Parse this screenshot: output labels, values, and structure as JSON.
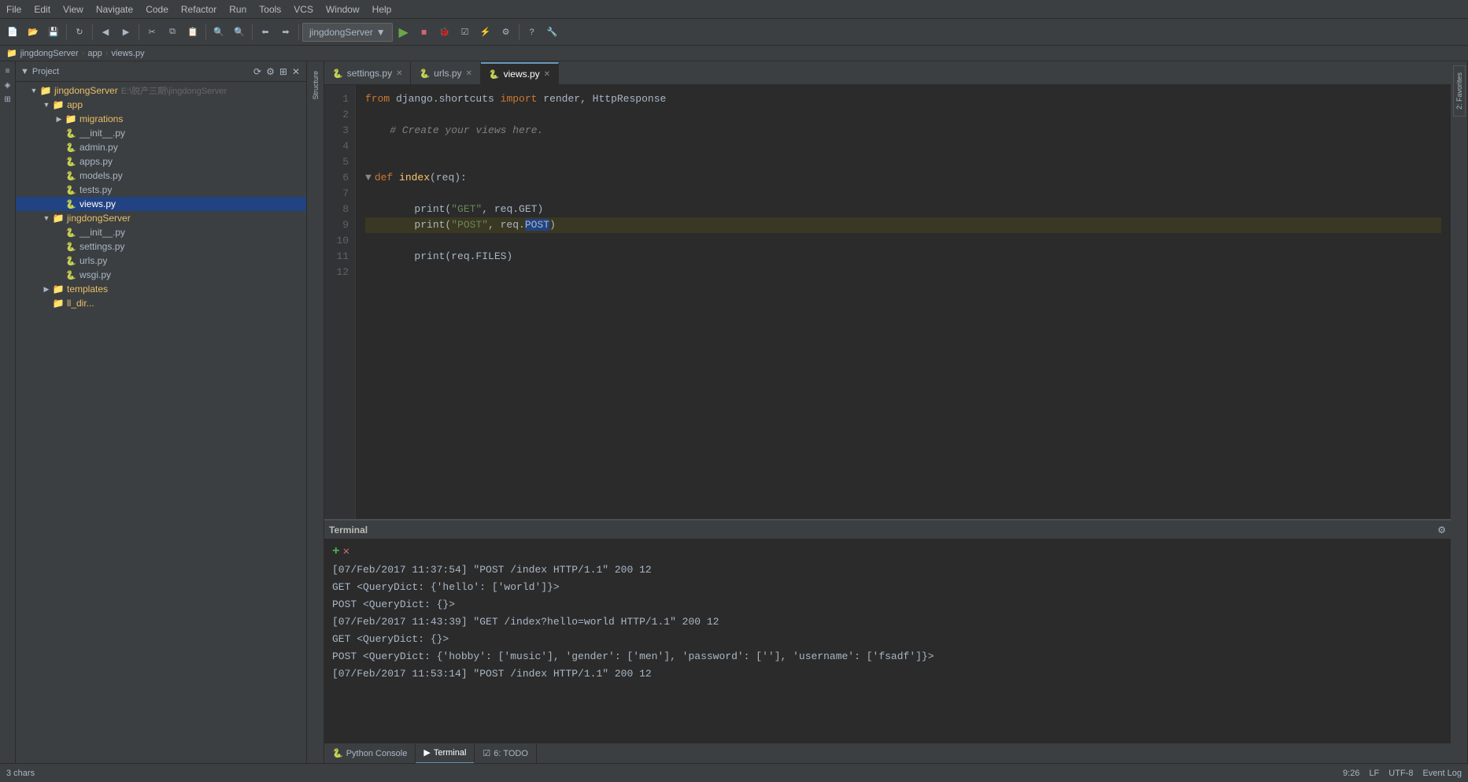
{
  "menubar": {
    "items": [
      "File",
      "Edit",
      "View",
      "Navigate",
      "Code",
      "Refactor",
      "Run",
      "Tools",
      "VCS",
      "Window",
      "Help"
    ]
  },
  "toolbar": {
    "project_dropdown": "jingdongServer",
    "buttons": [
      "new",
      "open",
      "save",
      "back",
      "forward",
      "cut",
      "copy",
      "paste",
      "search_minus",
      "search_plus",
      "back2",
      "forward2"
    ]
  },
  "breadcrumb": {
    "items": [
      "jingdongServer",
      "app",
      "views.py"
    ]
  },
  "tabs": [
    {
      "label": "settings.py",
      "active": false,
      "closeable": true
    },
    {
      "label": "urls.py",
      "active": false,
      "closeable": true
    },
    {
      "label": "views.py",
      "active": true,
      "closeable": true
    }
  ],
  "project_panel": {
    "title": "Project",
    "root": {
      "label": "jingdongServer",
      "path": "E:\\脱产三期\\jingdongServer",
      "children": [
        {
          "label": "app",
          "type": "folder",
          "expanded": true,
          "children": [
            {
              "label": "migrations",
              "type": "folder",
              "expanded": false
            },
            {
              "label": "__init__.py",
              "type": "python"
            },
            {
              "label": "admin.py",
              "type": "python"
            },
            {
              "label": "apps.py",
              "type": "python"
            },
            {
              "label": "models.py",
              "type": "python"
            },
            {
              "label": "tests.py",
              "type": "python"
            },
            {
              "label": "views.py",
              "type": "python",
              "selected": true
            }
          ]
        },
        {
          "label": "jingdongServer",
          "type": "folder",
          "expanded": true,
          "children": [
            {
              "label": "__init__.py",
              "type": "python"
            },
            {
              "label": "settings.py",
              "type": "python"
            },
            {
              "label": "urls.py",
              "type": "python"
            },
            {
              "label": "wsgi.py",
              "type": "python"
            }
          ]
        },
        {
          "label": "templates",
          "type": "folder",
          "expanded": false
        },
        {
          "label": "...",
          "type": "more"
        }
      ]
    }
  },
  "code": {
    "lines": [
      {
        "num": 1,
        "content": "from django.shortcuts import render, HttpResponse",
        "tokens": [
          {
            "type": "kw",
            "text": "from"
          },
          {
            "type": "normal",
            "text": " django.shortcuts "
          },
          {
            "type": "kw",
            "text": "import"
          },
          {
            "type": "normal",
            "text": " render, HttpResponse"
          }
        ]
      },
      {
        "num": 2,
        "content": "",
        "tokens": []
      },
      {
        "num": 3,
        "content": "    # Create your views here.",
        "tokens": [
          {
            "type": "comment",
            "text": "# Create your views here."
          }
        ]
      },
      {
        "num": 4,
        "content": "",
        "tokens": []
      },
      {
        "num": 5,
        "content": "",
        "tokens": []
      },
      {
        "num": 6,
        "content": "def index(req):",
        "tokens": [
          {
            "type": "kw",
            "text": "def"
          },
          {
            "type": "normal",
            "text": " "
          },
          {
            "type": "fn",
            "text": "index"
          },
          {
            "type": "normal",
            "text": "(req):"
          }
        ]
      },
      {
        "num": 7,
        "content": "",
        "tokens": []
      },
      {
        "num": 8,
        "content": "        print(\"GET\", req.GET)",
        "tokens": [
          {
            "type": "normal",
            "text": "        print("
          },
          {
            "type": "str",
            "text": "\"GET\""
          },
          {
            "type": "normal",
            "text": ", req.GET)"
          }
        ]
      },
      {
        "num": 9,
        "content": "        print(\"POST\", req.POST)",
        "highlighted": true,
        "tokens": [
          {
            "type": "normal",
            "text": "        print("
          },
          {
            "type": "str",
            "text": "\"POST\""
          },
          {
            "type": "normal",
            "text": ", req."
          },
          {
            "type": "selected",
            "text": "POST"
          },
          {
            "type": "normal",
            "text": ")"
          }
        ]
      },
      {
        "num": 10,
        "content": "",
        "tokens": []
      },
      {
        "num": 11,
        "content": "        print(req.FILES)",
        "tokens": [
          {
            "type": "normal",
            "text": "        print(req.FILES)"
          }
        ]
      },
      {
        "num": 12,
        "content": "",
        "tokens": []
      }
    ]
  },
  "terminal": {
    "title": "Terminal",
    "lines": [
      "[07/Feb/2017 11:37:54] \"POST /index HTTP/1.1\" 200 12",
      "GET <QueryDict: {'hello': ['world']}>",
      "POST <QueryDict: {}>",
      "[07/Feb/2017 11:43:39] \"GET /index?hello=world HTTP/1.1\" 200 12",
      "GET <QueryDict: {}>",
      "POST <QueryDict: {'hobby': ['music'], 'gender': ['men'], 'password': [''], 'username': ['fsadf']}>",
      "[07/Feb/2017 11:53:14] \"POST /index HTTP/1.1\" 200 12"
    ]
  },
  "bottom_tabs": [
    {
      "label": "Python Console",
      "icon": "🐍",
      "active": false
    },
    {
      "label": "Terminal",
      "icon": "▶",
      "active": true
    },
    {
      "label": "6: TODO",
      "icon": "☑",
      "active": false
    }
  ],
  "status_bar": {
    "left": [
      "3 chars"
    ],
    "right": [
      "9:26",
      "LF",
      "UTF-8",
      "Event Log"
    ]
  },
  "right_sidebar": {
    "items": [
      "Structure",
      "2: Favorites"
    ]
  }
}
